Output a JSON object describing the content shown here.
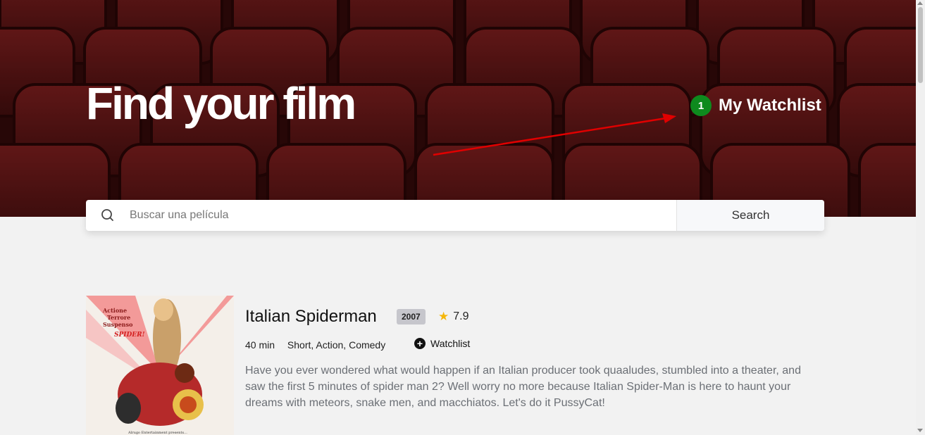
{
  "header": {
    "title": "Find your film",
    "watchlist_count": "1",
    "watchlist_label": "My Watchlist"
  },
  "search": {
    "placeholder": "Buscar una película",
    "value": "",
    "button_label": "Search",
    "icon": "search-icon"
  },
  "movie": {
    "title": "Italian Spiderman",
    "year": "2007",
    "rating": "7.9",
    "duration": "40 min",
    "genres": "Short, Action, Comedy",
    "watchlist_button": "Watchlist",
    "overview": "Have you ever wondered what would happen if an Italian producer took quaaludes, stumbled into a theater, and saw the first 5 minutes of spider man 2? Well worry no more because Italian Spider-Man is here to haunt your dreams with meteors, snake men, and macchiatos. Let's do it PussyCat!",
    "poster": {
      "line1": "Actione",
      "line2": "Terrore",
      "line3": "Suspenso",
      "line4": "SPIDER!",
      "credit": "Alrugo Entertainment presents..."
    }
  },
  "colors": {
    "badge_green": "#0e8a1e",
    "hero_dark_red": "#3a0d0d",
    "arrow_red": "#e00000",
    "star": "#f5b70a"
  }
}
